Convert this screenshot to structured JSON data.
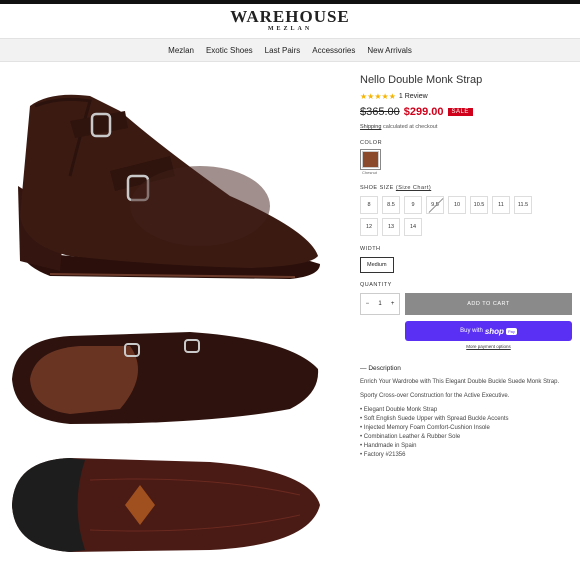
{
  "brand": {
    "name": "WAREHOUSE",
    "subtitle": "MEZLAN"
  },
  "nav": [
    "Mezlan",
    "Exotic Shoes",
    "Last Pairs",
    "Accessories",
    "New Arrivals"
  ],
  "product": {
    "title": "Nello Double Monk Strap",
    "rating_stars": "★★★★★",
    "reviews": "1 Review",
    "old_price": "$365.00",
    "new_price": "$299.00",
    "sale_badge": "SALE",
    "shipping_link": "Shipping",
    "shipping_text": " calculated at checkout",
    "color_label": "COLOR",
    "color_name": "Chesnut",
    "color_hex": "#8b4a2b",
    "size_label": "SHOE SIZE",
    "size_chart": "(Size Chart)",
    "sizes": [
      "8",
      "8.5",
      "9",
      "9.5",
      "10",
      "10.5",
      "11",
      "11.5",
      "12",
      "13",
      "14"
    ],
    "width_label": "WIDTH",
    "width_value": "Medium",
    "qty_label": "QUANTITY",
    "qty_value": "1",
    "qty_minus": "−",
    "qty_plus": "+",
    "add_to_cart": "ADD TO CART",
    "buy_with": "Buy with",
    "shop": "shop",
    "pay": "Pay",
    "more_payment": "More payment options"
  },
  "description": {
    "heading": "Description",
    "p1": "Enrich Your Wardrobe with This Elegant Double Buckle Suede Monk Strap.",
    "p2": "Sporty Cross-over Construction for the Active Executive.",
    "features": [
      "Elegant Double Monk Strap",
      "Soft English Suede Upper with Spread Buckle Accents",
      "Injected Memory Foam Comfort-Cushion Insole",
      "Combination Leather & Rubber Sole",
      "Handmade in Spain",
      "Factory #21356"
    ]
  },
  "colors": {
    "accent_red": "#d0021b",
    "shop_pay": "#5a31f4",
    "suede": "#3b1a12"
  }
}
